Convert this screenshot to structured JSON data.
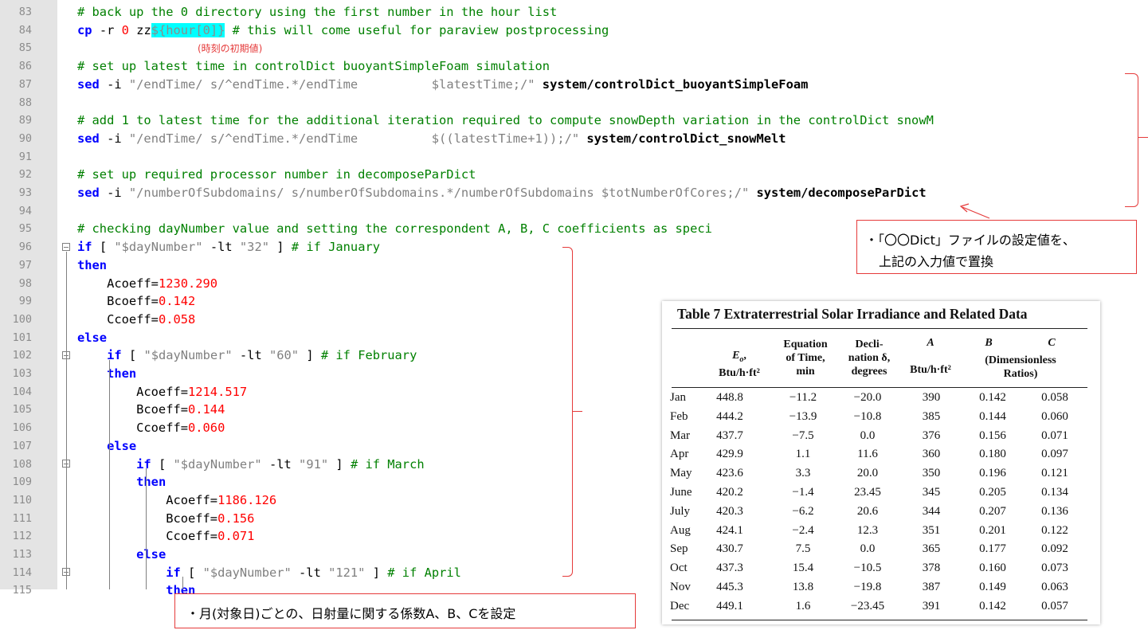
{
  "editor": {
    "lines": [
      {
        "n": "83",
        "tokens": [
          {
            "c": "cm",
            "t": "# back up the 0 directory using the first number in the hour list"
          }
        ]
      },
      {
        "n": "84",
        "tokens": [
          {
            "c": "kw",
            "t": "cp "
          },
          {
            "c": "plain",
            "t": "-r "
          },
          {
            "c": "num",
            "t": "0 "
          },
          {
            "c": "plain",
            "t": "zz"
          },
          {
            "c": "hl",
            "t": "${hour[0]}"
          },
          {
            "c": "cm",
            "t": " # this will come useful for paraview postprocessing"
          }
        ]
      },
      {
        "n": "85",
        "tokens": []
      },
      {
        "n": "86",
        "tokens": [
          {
            "c": "cm",
            "t": "# set up latest time in controlDict buoyantSimpleFoam simulation"
          }
        ]
      },
      {
        "n": "87",
        "tokens": [
          {
            "c": "kw",
            "t": "sed "
          },
          {
            "c": "plain",
            "t": "-i "
          },
          {
            "c": "str",
            "t": "\"/endTime/ s/^endTime.*/endTime          $latestTime;/\""
          },
          {
            "c": "bold",
            "t": " system/controlDict_buoyantSimpleFoam"
          }
        ]
      },
      {
        "n": "88",
        "tokens": []
      },
      {
        "n": "89",
        "tokens": [
          {
            "c": "cm",
            "t": "# add 1 to latest time for the additional iteration required to compute snowDepth variation in the controlDict snowM"
          }
        ]
      },
      {
        "n": "90",
        "tokens": [
          {
            "c": "kw",
            "t": "sed "
          },
          {
            "c": "plain",
            "t": "-i "
          },
          {
            "c": "str",
            "t": "\"/endTime/ s/^endTime.*/endTime          $((latestTime+1));/\""
          },
          {
            "c": "bold",
            "t": " system/controlDict_snowMelt"
          }
        ]
      },
      {
        "n": "91",
        "tokens": []
      },
      {
        "n": "92",
        "tokens": [
          {
            "c": "cm",
            "t": "# set up required processor number in decomposeParDict"
          }
        ]
      },
      {
        "n": "93",
        "tokens": [
          {
            "c": "kw",
            "t": "sed "
          },
          {
            "c": "plain",
            "t": "-i "
          },
          {
            "c": "str",
            "t": "\"/numberOfSubdomains/ s/numberOfSubdomains.*/numberOfSubdomains $totNumberOfCores;/\""
          },
          {
            "c": "bold",
            "t": " system/decomposeParDict"
          }
        ]
      },
      {
        "n": "94",
        "tokens": []
      },
      {
        "n": "95",
        "tokens": [
          {
            "c": "cm",
            "t": "# checking dayNumber value and setting the correspondent A, B, C coefficients as speci"
          }
        ]
      },
      {
        "n": "96",
        "tokens": [
          {
            "c": "kw",
            "t": "if "
          },
          {
            "c": "plain",
            "t": "[ "
          },
          {
            "c": "str",
            "t": "\"$dayNumber\""
          },
          {
            "c": "plain",
            "t": " -lt "
          },
          {
            "c": "str",
            "t": "\"32\""
          },
          {
            "c": "plain",
            "t": " ]"
          },
          {
            "c": "cm",
            "t": " # if January"
          }
        ]
      },
      {
        "n": "97",
        "tokens": [
          {
            "c": "kw",
            "t": "then"
          }
        ]
      },
      {
        "n": "98",
        "tokens": [
          {
            "c": "plain",
            "t": "    Acoeff="
          },
          {
            "c": "num",
            "t": "1230.290"
          }
        ]
      },
      {
        "n": "99",
        "tokens": [
          {
            "c": "plain",
            "t": "    Bcoeff="
          },
          {
            "c": "num",
            "t": "0.142"
          }
        ]
      },
      {
        "n": "100",
        "tokens": [
          {
            "c": "plain",
            "t": "    Ccoeff="
          },
          {
            "c": "num",
            "t": "0.058"
          }
        ]
      },
      {
        "n": "101",
        "tokens": [
          {
            "c": "kw",
            "t": "else"
          }
        ]
      },
      {
        "n": "102",
        "tokens": [
          {
            "c": "plain",
            "t": "    "
          },
          {
            "c": "kw",
            "t": "if "
          },
          {
            "c": "plain",
            "t": "[ "
          },
          {
            "c": "str",
            "t": "\"$dayNumber\""
          },
          {
            "c": "plain",
            "t": " -lt "
          },
          {
            "c": "str",
            "t": "\"60\""
          },
          {
            "c": "plain",
            "t": " ]"
          },
          {
            "c": "cm",
            "t": " # if February"
          }
        ]
      },
      {
        "n": "103",
        "tokens": [
          {
            "c": "plain",
            "t": "    "
          },
          {
            "c": "kw",
            "t": "then"
          }
        ]
      },
      {
        "n": "104",
        "tokens": [
          {
            "c": "plain",
            "t": "        Acoeff="
          },
          {
            "c": "num",
            "t": "1214.517"
          }
        ]
      },
      {
        "n": "105",
        "tokens": [
          {
            "c": "plain",
            "t": "        Bcoeff="
          },
          {
            "c": "num",
            "t": "0.144"
          }
        ]
      },
      {
        "n": "106",
        "tokens": [
          {
            "c": "plain",
            "t": "        Ccoeff="
          },
          {
            "c": "num",
            "t": "0.060"
          }
        ]
      },
      {
        "n": "107",
        "tokens": [
          {
            "c": "plain",
            "t": "    "
          },
          {
            "c": "kw",
            "t": "else"
          }
        ]
      },
      {
        "n": "108",
        "tokens": [
          {
            "c": "plain",
            "t": "        "
          },
          {
            "c": "kw",
            "t": "if "
          },
          {
            "c": "plain",
            "t": "[ "
          },
          {
            "c": "str",
            "t": "\"$dayNumber\""
          },
          {
            "c": "plain",
            "t": " -lt "
          },
          {
            "c": "str",
            "t": "\"91\""
          },
          {
            "c": "plain",
            "t": " ]"
          },
          {
            "c": "cm",
            "t": " # if March"
          }
        ]
      },
      {
        "n": "109",
        "tokens": [
          {
            "c": "plain",
            "t": "        "
          },
          {
            "c": "kw",
            "t": "then"
          }
        ]
      },
      {
        "n": "110",
        "tokens": [
          {
            "c": "plain",
            "t": "            Acoeff="
          },
          {
            "c": "num",
            "t": "1186.126"
          }
        ]
      },
      {
        "n": "111",
        "tokens": [
          {
            "c": "plain",
            "t": "            Bcoeff="
          },
          {
            "c": "num",
            "t": "0.156"
          }
        ]
      },
      {
        "n": "112",
        "tokens": [
          {
            "c": "plain",
            "t": "            Ccoeff="
          },
          {
            "c": "num",
            "t": "0.071"
          }
        ]
      },
      {
        "n": "113",
        "tokens": [
          {
            "c": "plain",
            "t": "        "
          },
          {
            "c": "kw",
            "t": "else"
          }
        ]
      },
      {
        "n": "114",
        "tokens": [
          {
            "c": "plain",
            "t": "            "
          },
          {
            "c": "kw",
            "t": "if "
          },
          {
            "c": "plain",
            "t": "[ "
          },
          {
            "c": "str",
            "t": "\"$dayNumber\""
          },
          {
            "c": "plain",
            "t": " -lt "
          },
          {
            "c": "str",
            "t": "\"121\""
          },
          {
            "c": "plain",
            "t": " ]"
          },
          {
            "c": "cm",
            "t": " # if April"
          }
        ]
      },
      {
        "n": "115",
        "tokens": [
          {
            "c": "plain",
            "t": "            "
          },
          {
            "c": "kw",
            "t": "then"
          }
        ]
      }
    ]
  },
  "annotations": {
    "initial_hour_note": "(時刻の初期値)",
    "dict_note_line1": "・「〇〇Dict」ファイルの設定値を、",
    "dict_note_line2": "上記の入力値で置換",
    "coeff_note": "・月(対象日)ごとの、日射量に関する係数A、B、Cを設定"
  },
  "table": {
    "title": "Table 7    Extraterrestrial Solar Irradiance and Related Data",
    "headers": {
      "eo_top": "E",
      "eo_sub": "o",
      "eo_unit": "Btu/h·ft²",
      "eq_l1": "Equation",
      "eq_l2": "of Time,",
      "eq_l3": "min",
      "dec_l1": "Decli-",
      "dec_l2": "nation δ,",
      "dec_l3": "degrees",
      "a_l1": "A",
      "a_l2": "Btu/h·ft²",
      "b_l1": "B",
      "c_l1": "C",
      "bc_l2": "(Dimensionless",
      "bc_l3": "Ratios)"
    },
    "rows": [
      [
        "Jan",
        "448.8",
        "−11.2",
        "−20.0",
        "390",
        "0.142",
        "0.058"
      ],
      [
        "Feb",
        "444.2",
        "−13.9",
        "−10.8",
        "385",
        "0.144",
        "0.060"
      ],
      [
        "Mar",
        "437.7",
        "−7.5",
        "0.0",
        "376",
        "0.156",
        "0.071"
      ],
      [
        "Apr",
        "429.9",
        "1.1",
        "11.6",
        "360",
        "0.180",
        "0.097"
      ],
      [
        "May",
        "423.6",
        "3.3",
        "20.0",
        "350",
        "0.196",
        "0.121"
      ],
      [
        "June",
        "420.2",
        "−1.4",
        "23.45",
        "345",
        "0.205",
        "0.134"
      ],
      [
        "July",
        "420.3",
        "−6.2",
        "20.6",
        "344",
        "0.207",
        "0.136"
      ],
      [
        "Aug",
        "424.1",
        "−2.4",
        "12.3",
        "351",
        "0.201",
        "0.122"
      ],
      [
        "Sep",
        "430.7",
        "7.5",
        "0.0",
        "365",
        "0.177",
        "0.092"
      ],
      [
        "Oct",
        "437.3",
        "15.4",
        "−10.5",
        "378",
        "0.160",
        "0.073"
      ],
      [
        "Nov",
        "445.3",
        "13.8",
        "−19.8",
        "387",
        "0.149",
        "0.063"
      ],
      [
        "Dec",
        "449.1",
        "1.6",
        "−23.45",
        "391",
        "0.142",
        "0.057"
      ]
    ]
  }
}
